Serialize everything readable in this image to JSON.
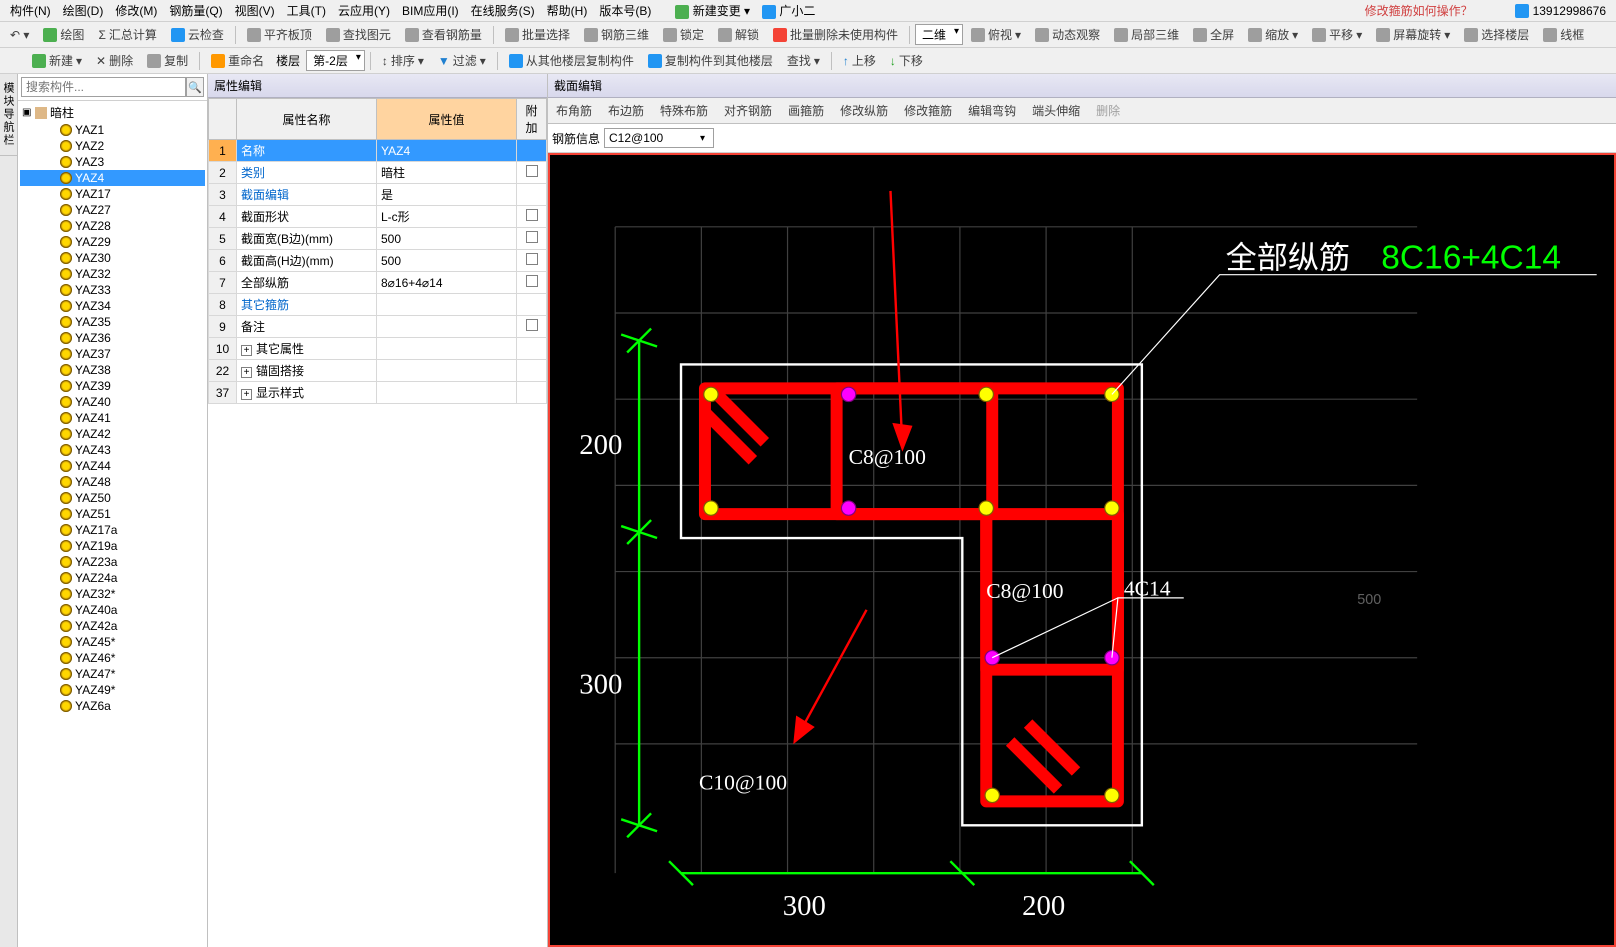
{
  "menu": {
    "items": [
      "构件(N)",
      "绘图(D)",
      "修改(M)",
      "钢筋量(Q)",
      "视图(V)",
      "工具(T)",
      "云应用(Y)",
      "BIM应用(I)",
      "在线服务(S)",
      "帮助(H)",
      "版本号(B)"
    ],
    "new_change": "新建变更",
    "assistant": "广小二",
    "help_link": "修改箍筋如何操作？",
    "user": "13912998676"
  },
  "toolbar1": {
    "draw": "绘图",
    "sum": "汇总计算",
    "cloud": "云检查",
    "flat": "平齐板顶",
    "find": "查找图元",
    "viewsteel": "查看钢筋量",
    "batch_sel": "批量选择",
    "steel3d": "钢筋三维",
    "lock": "锁定",
    "unlock": "解锁",
    "batch_del": "批量删除未使用构件",
    "view2d": "二维",
    "bird": "俯视",
    "dyn": "动态观察",
    "local3d": "局部三维",
    "full": "全屏",
    "zoom": "缩放",
    "pan": "平移",
    "rotate": "屏幕旋转",
    "sel_floor": "选择楼层",
    "wire": "线框"
  },
  "toolbar2": {
    "new": "新建",
    "del": "删除",
    "copy": "复制",
    "rename": "重命名",
    "floor_label": "楼层",
    "floor_value": "第-2层",
    "sort": "排序",
    "filter": "过滤",
    "copy_from": "从其他楼层复制构件",
    "copy_to": "复制构件到其他楼层",
    "find": "查找",
    "up": "上移",
    "down": "下移"
  },
  "search_placeholder": "搜索构件...",
  "tree": {
    "root": "暗柱",
    "items": [
      "YAZ1",
      "YAZ2",
      "YAZ3",
      "YAZ4",
      "YAZ17",
      "YAZ27",
      "YAZ28",
      "YAZ29",
      "YAZ30",
      "YAZ32",
      "YAZ33",
      "YAZ34",
      "YAZ35",
      "YAZ36",
      "YAZ37",
      "YAZ38",
      "YAZ39",
      "YAZ40",
      "YAZ41",
      "YAZ42",
      "YAZ43",
      "YAZ44",
      "YAZ48",
      "YAZ50",
      "YAZ51",
      "YAZ17a",
      "YAZ19a",
      "YAZ23a",
      "YAZ24a",
      "YAZ32*",
      "YAZ40a",
      "YAZ42a",
      "YAZ45*",
      "YAZ46*",
      "YAZ47*",
      "YAZ49*",
      "YAZ6a"
    ],
    "selected": "YAZ4"
  },
  "side_tabs": [
    "模块导航栏"
  ],
  "props": {
    "title": "属性编辑",
    "header_name": "属性名称",
    "header_value": "属性值",
    "header_extra": "附加",
    "rows": [
      {
        "n": "1",
        "name": "名称",
        "value": "YAZ4",
        "link": false,
        "extra": "",
        "selected": true
      },
      {
        "n": "2",
        "name": "类别",
        "value": "暗柱",
        "link": true,
        "extra": "cb"
      },
      {
        "n": "3",
        "name": "截面编辑",
        "value": "是",
        "link": true,
        "extra": ""
      },
      {
        "n": "4",
        "name": "截面形状",
        "value": "L-c形",
        "link": false,
        "extra": "cb"
      },
      {
        "n": "5",
        "name": "截面宽(B边)(mm)",
        "value": "500",
        "link": false,
        "extra": "cb"
      },
      {
        "n": "6",
        "name": "截面高(H边)(mm)",
        "value": "500",
        "link": false,
        "extra": "cb"
      },
      {
        "n": "7",
        "name": "全部纵筋",
        "value": "8⌀16+4⌀14",
        "link": false,
        "extra": "cb"
      },
      {
        "n": "8",
        "name": "其它箍筋",
        "value": "",
        "link": true,
        "extra": ""
      },
      {
        "n": "9",
        "name": "备注",
        "value": "",
        "link": false,
        "extra": "cb"
      },
      {
        "n": "10",
        "name": "其它属性",
        "value": "",
        "link": false,
        "extra": "exp"
      },
      {
        "n": "22",
        "name": "锚固搭接",
        "value": "",
        "link": false,
        "extra": "exp"
      },
      {
        "n": "37",
        "name": "显示样式",
        "value": "",
        "link": false,
        "extra": "exp"
      }
    ]
  },
  "section": {
    "title": "截面编辑",
    "tabs": [
      "布角筋",
      "布边筋",
      "特殊布筋",
      "对齐钢筋",
      "画箍筋",
      "修改纵筋",
      "修改箍筋",
      "编辑弯钩",
      "端头伸缩",
      "删除"
    ],
    "rebar_label": "钢筋信息",
    "rebar_value": "C12@100",
    "anno_all": "全部纵筋",
    "anno_all_v": "8C16+4C14",
    "anno_4c14": "4C14",
    "c8_100": "C8@100",
    "c10_100": "C10@100",
    "d300": "300",
    "d200": "200",
    "d300b": "300"
  }
}
